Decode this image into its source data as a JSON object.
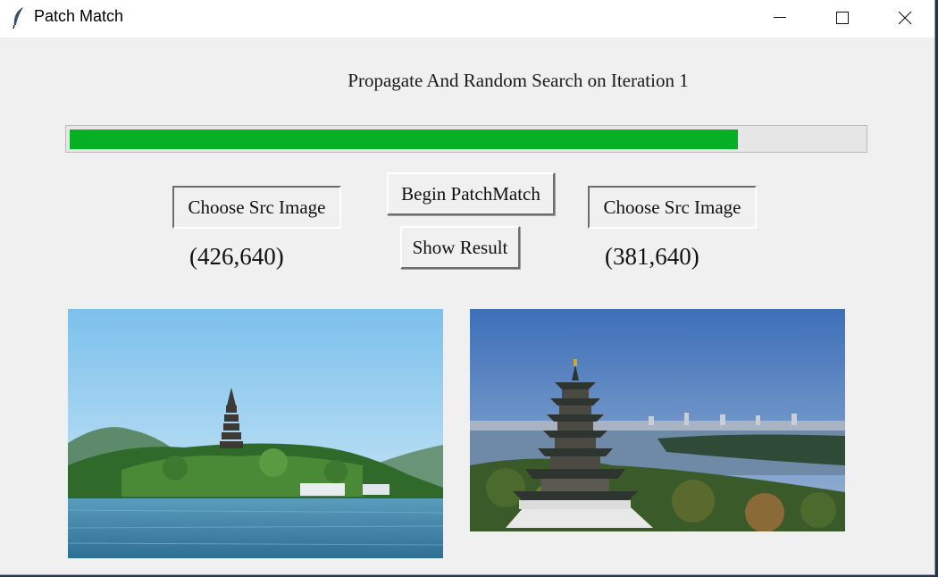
{
  "window": {
    "title": "Patch Match",
    "controls": {
      "minimize": "minimize-icon",
      "maximize": "maximize-icon",
      "close": "close-icon"
    }
  },
  "status": {
    "text": "Propagate And Random Search on Iteration 1"
  },
  "progress": {
    "fraction": 0.84,
    "color": "#06b025"
  },
  "buttons": {
    "choose_src_left": "Choose Src Image",
    "begin": "Begin PatchMatch",
    "show_result": "Show Result",
    "choose_src_right": "Choose Src Image"
  },
  "sizes": {
    "left": "(426,640)",
    "right": "(381,640)"
  },
  "images": {
    "left": "source-image-lake-pagoda",
    "right": "target-image-pagoda-aerial"
  }
}
